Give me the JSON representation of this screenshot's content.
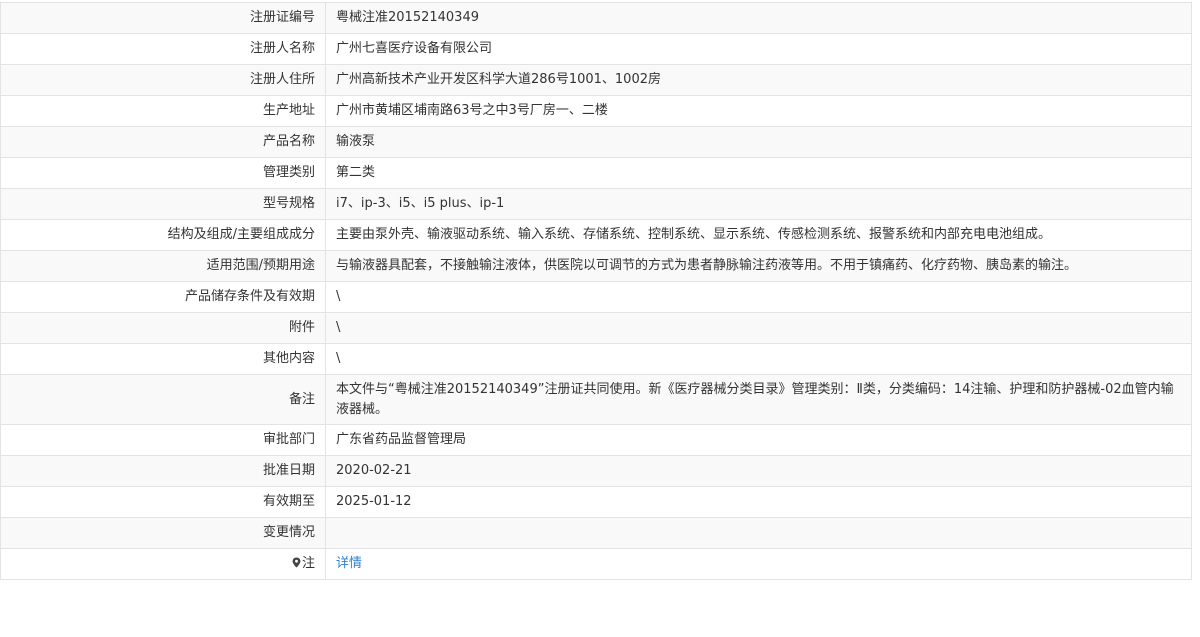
{
  "rows": [
    {
      "label": "注册证编号",
      "value": "粤械注准20152140349"
    },
    {
      "label": "注册人名称",
      "value": "广州七喜医疗设备有限公司"
    },
    {
      "label": "注册人住所",
      "value": "广州高新技术产业开发区科学大道286号1001、1002房"
    },
    {
      "label": "生产地址",
      "value": "广州市黄埔区埔南路63号之中3号厂房一、二楼"
    },
    {
      "label": "产品名称",
      "value": "输液泵"
    },
    {
      "label": "管理类别",
      "value": "第二类"
    },
    {
      "label": "型号规格",
      "value": "i7、ip-3、i5、i5 plus、ip-1"
    },
    {
      "label": "结构及组成/主要组成成分",
      "value": "主要由泵外壳、输液驱动系统、输入系统、存储系统、控制系统、显示系统、传感检测系统、报警系统和内部充电电池组成。"
    },
    {
      "label": "适用范围/预期用途",
      "value": "与输液器具配套，不接触输注液体，供医院以可调节的方式为患者静脉输注药液等用。不用于镇痛药、化疗药物、胰岛素的输注。"
    },
    {
      "label": "产品储存条件及有效期",
      "value": "\\"
    },
    {
      "label": "附件",
      "value": "\\"
    },
    {
      "label": "其他内容",
      "value": "\\"
    },
    {
      "label": "备注",
      "value": "本文件与“粤械注准20152140349”注册证共同使用。新《医疗器械分类目录》管理类别：Ⅱ类，分类编码：14注输、护理和防护器械-02血管内输液器械。"
    },
    {
      "label": "审批部门",
      "value": "广东省药品监督管理局"
    },
    {
      "label": "批准日期",
      "value": "2020-02-21"
    },
    {
      "label": "有效期至",
      "value": "2025-01-12"
    },
    {
      "label": "变更情况",
      "value": ""
    }
  ],
  "note_row": {
    "label": "注",
    "link_text": "详情",
    "icon": "map-pin-icon"
  }
}
